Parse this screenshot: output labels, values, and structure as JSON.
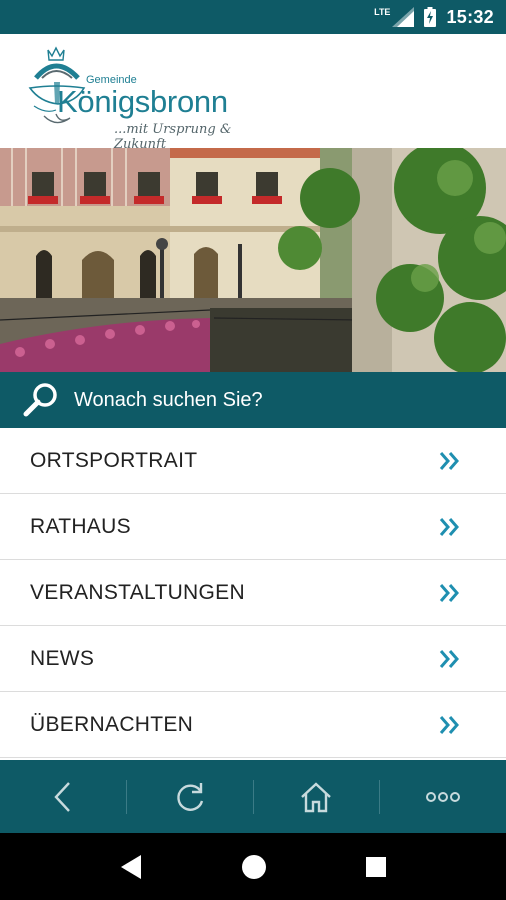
{
  "status_bar": {
    "network": "LTE",
    "time": "15:32",
    "icons": [
      "lte-signal-icon",
      "battery-charging-icon"
    ]
  },
  "header": {
    "logo_prefix": "Gemeinde",
    "logo_name": "Königsbronn",
    "logo_slogan": "...mit Ursprung & Zukunft",
    "logo_icon": "crowned-fountain-emblem"
  },
  "hero": {
    "image": "town-hall-photo"
  },
  "search": {
    "placeholder": "Wonach suchen Sie?",
    "icon": "search-icon"
  },
  "menu": {
    "items": [
      {
        "label": "ORTSPORTRAIT"
      },
      {
        "label": "RATHAUS"
      },
      {
        "label": "VERANSTALTUNGEN"
      },
      {
        "label": "NEWS"
      },
      {
        "label": "ÜBERNACHTEN"
      }
    ],
    "item_icon": "double-chevron-right-icon"
  },
  "toolbar": {
    "buttons": [
      "back-icon",
      "reload-icon",
      "home-icon",
      "more-icon"
    ]
  },
  "nav_bar": {
    "buttons": [
      "nav-back-icon",
      "nav-home-icon",
      "nav-recents-icon"
    ]
  },
  "colors": {
    "primary": "#0e5a66",
    "accent": "#1f8fb0",
    "text": "#222222"
  }
}
